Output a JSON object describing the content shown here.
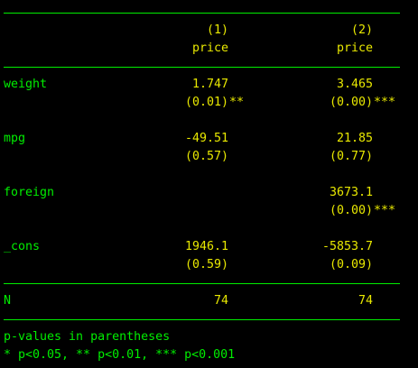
{
  "table": {
    "header": {
      "col1_num": "(1)",
      "col1_var": "price",
      "col2_num": "(2)",
      "col2_var": "price"
    },
    "rows": [
      {
        "label": "weight",
        "c1": "1.747",
        "c1_p": "(0.01)",
        "c1_star": "**",
        "c2": "3.465",
        "c2_p": "(0.00)",
        "c2_star": "***"
      },
      {
        "label": "mpg",
        "c1": "-49.51",
        "c1_p": "(0.57)",
        "c1_star": "",
        "c2": "21.85",
        "c2_p": "(0.77)",
        "c2_star": ""
      },
      {
        "label": "foreign",
        "c1": "",
        "c1_p": "",
        "c1_star": "",
        "c2": "3673.1",
        "c2_p": "(0.00)",
        "c2_star": "***"
      },
      {
        "label": "_cons",
        "c1": "1946.1",
        "c1_p": "(0.59)",
        "c1_star": "",
        "c2": "-5853.7",
        "c2_p": "(0.09)",
        "c2_star": ""
      }
    ],
    "n_row": {
      "label": "N",
      "c1": "74",
      "c2": "74"
    },
    "notes": {
      "line1": "p-values in parentheses",
      "line2": "* p<0.05, ** p<0.01, *** p<0.001"
    }
  },
  "colors": {
    "label": "#00ee00",
    "value": "#e8e800",
    "background": "#000000"
  }
}
